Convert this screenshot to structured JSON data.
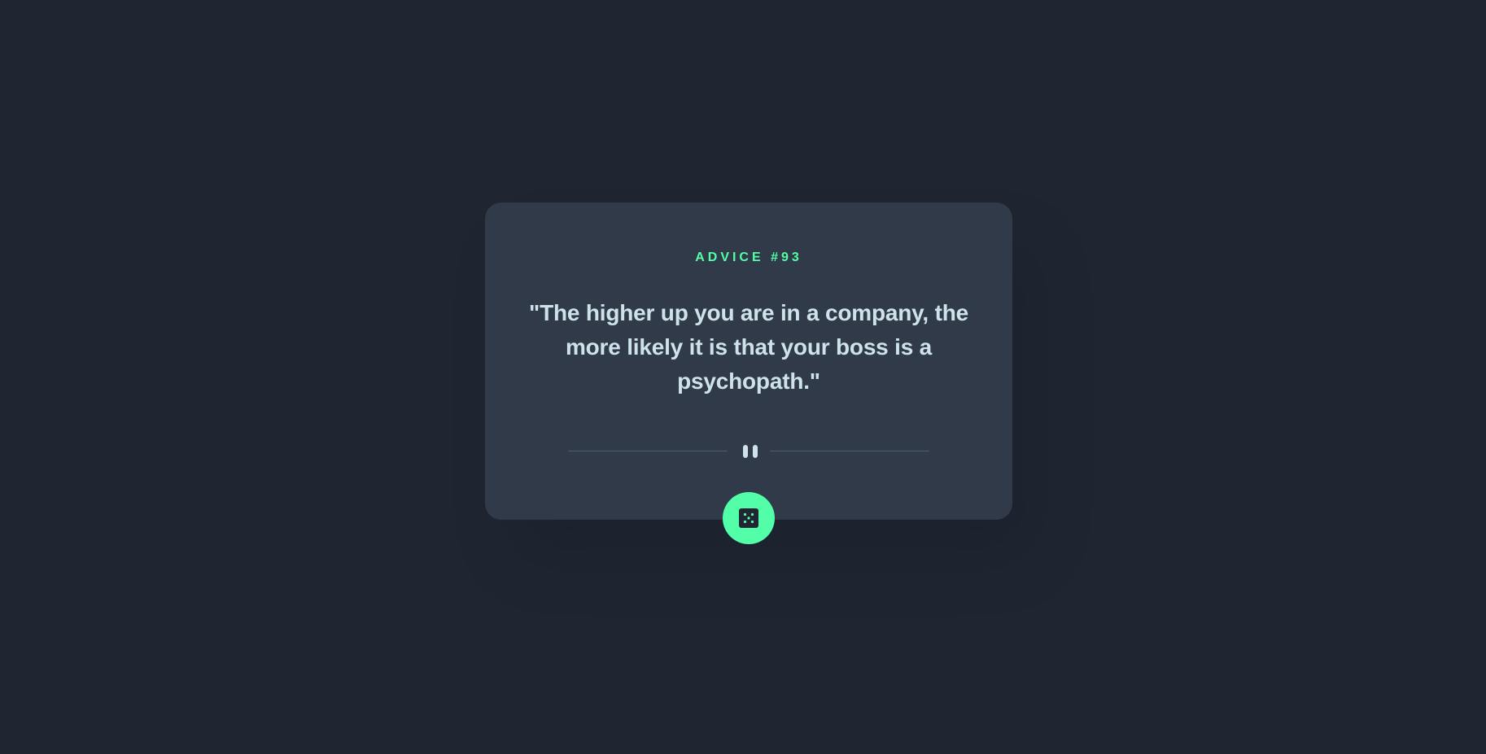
{
  "advice": {
    "label": "ADVICE #93",
    "text": "\"The higher up you are in a company, the more likely it is that your boss is a psychopath.\""
  },
  "divider": {
    "icon": "pause-quote-icon"
  },
  "generate_button": {
    "icon": "dice-icon"
  },
  "colors": {
    "background": "#1f2632",
    "card": "#313a48",
    "accent": "#52ffa8",
    "text": "#cee3e9",
    "divider_line": "#4f5d74"
  }
}
